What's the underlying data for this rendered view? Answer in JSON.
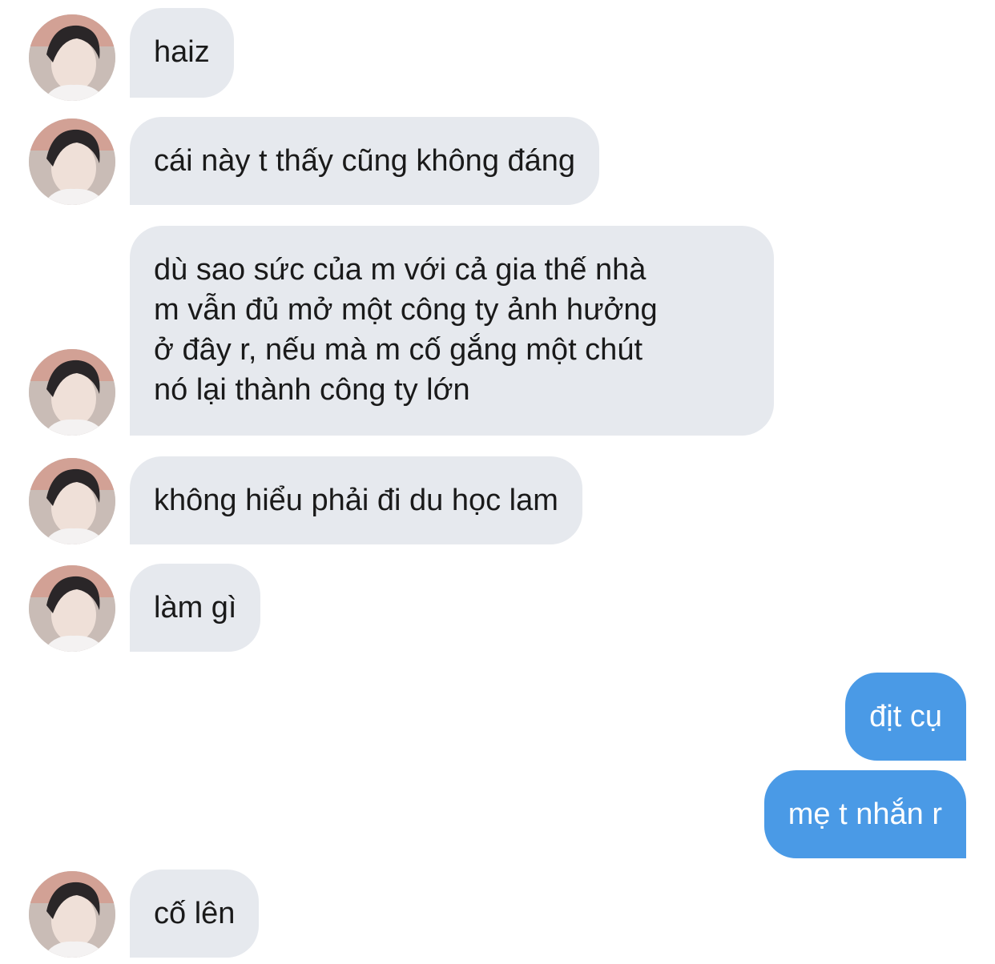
{
  "theme": {
    "incoming_bubble_color": "#e6e9ee",
    "outgoing_bubble_color": "#4a9ae6",
    "incoming_text_color": "#1a1a1a",
    "outgoing_text_color": "#ffffff"
  },
  "messages": [
    {
      "direction": "incoming",
      "text": "haiz",
      "avatar": "user-avatar"
    },
    {
      "direction": "incoming",
      "text": "cái này t thấy cũng không đáng",
      "avatar": "user-avatar"
    },
    {
      "direction": "incoming",
      "text": "dù sao sức của m với cả gia thế nhà\nm vẫn đủ mở một công ty ảnh hưởng\nở đây r, nếu mà m cố gắng một chút\nnó lại thành công ty lớn",
      "avatar": "user-avatar"
    },
    {
      "direction": "incoming",
      "text": "không hiểu phải đi du học lam",
      "avatar": "user-avatar"
    },
    {
      "direction": "incoming",
      "text": "làm gì",
      "avatar": "user-avatar"
    },
    {
      "direction": "outgoing",
      "text": "địt cụ"
    },
    {
      "direction": "outgoing",
      "text": "mẹ t nhắn r"
    },
    {
      "direction": "incoming",
      "text": "cố lên",
      "avatar": "user-avatar"
    }
  ]
}
